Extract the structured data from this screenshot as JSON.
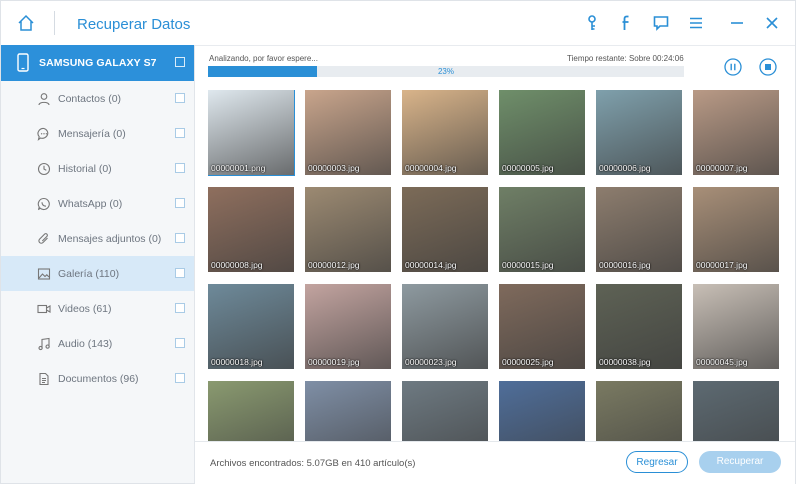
{
  "window": {
    "title": "Recuperar Datos"
  },
  "toolbar": {
    "icons": [
      "key-icon",
      "facebook-icon",
      "chat-icon",
      "menu-icon",
      "minimize-icon",
      "close-icon"
    ]
  },
  "sidebar": {
    "device": "SAMSUNG GALAXY S7",
    "items": [
      {
        "label": "Contactos (0)",
        "icon": "contact-icon"
      },
      {
        "label": "Mensajería (0)",
        "icon": "message-icon"
      },
      {
        "label": "Historial (0)",
        "icon": "history-icon"
      },
      {
        "label": "WhatsApp (0)",
        "icon": "whatsapp-icon"
      },
      {
        "label": "Mensajes adjuntos (0)",
        "icon": "attachment-icon"
      },
      {
        "label": "Galería (110)",
        "icon": "gallery-icon",
        "active": true
      },
      {
        "label": "Videos (61)",
        "icon": "video-icon"
      },
      {
        "label": "Audio (143)",
        "icon": "audio-icon"
      },
      {
        "label": "Documentos (96)",
        "icon": "document-icon"
      }
    ]
  },
  "progress": {
    "status": "Analizando, por favor espere...",
    "remaining": "Tiempo restante: Sobre 00:24:06",
    "percent_label": "23%",
    "percent": 23
  },
  "thumbnails": [
    {
      "name": "00000001.png",
      "color": "#dfe8ee",
      "selected": true
    },
    {
      "name": "00000003.jpg",
      "color": "#c9a58c"
    },
    {
      "name": "00000004.jpg",
      "color": "#d9b48a"
    },
    {
      "name": "00000005.jpg",
      "color": "#6f8f6a"
    },
    {
      "name": "00000006.jpg",
      "color": "#7fa0ac"
    },
    {
      "name": "00000007.jpg",
      "color": "#b99a86"
    },
    {
      "name": "00000008.jpg",
      "color": "#8f6f5e"
    },
    {
      "name": "00000012.jpg",
      "color": "#9c8a72"
    },
    {
      "name": "00000014.jpg",
      "color": "#7c6b58"
    },
    {
      "name": "00000015.jpg",
      "color": "#6f7f66"
    },
    {
      "name": "00000016.jpg",
      "color": "#8d7d6e"
    },
    {
      "name": "00000017.jpg",
      "color": "#a88f78"
    },
    {
      "name": "00000018.jpg",
      "color": "#6e8a9a"
    },
    {
      "name": "00000019.jpg",
      "color": "#c3a4a0"
    },
    {
      "name": "00000023.jpg",
      "color": "#8e9aa0"
    },
    {
      "name": "00000025.jpg",
      "color": "#7f6a5c"
    },
    {
      "name": "00000038.jpg",
      "color": "#5e6255"
    },
    {
      "name": "00000045.jpg",
      "color": "#c8bfb6"
    },
    {
      "name": "",
      "color": "#8a9a70"
    },
    {
      "name": "",
      "color": "#7f8fa6"
    },
    {
      "name": "",
      "color": "#6e7a82"
    },
    {
      "name": "",
      "color": "#4f6e9a"
    },
    {
      "name": "",
      "color": "#7a7a62"
    },
    {
      "name": "",
      "color": "#5d6a72"
    }
  ],
  "footer": {
    "found": "Archivos encontrados:  5.07GB en 410 artículo(s)",
    "back": "Regresar",
    "recover": "Recuperar"
  },
  "colors": {
    "accent": "#2a8fd6",
    "active_bg": "#d7e9f8"
  }
}
